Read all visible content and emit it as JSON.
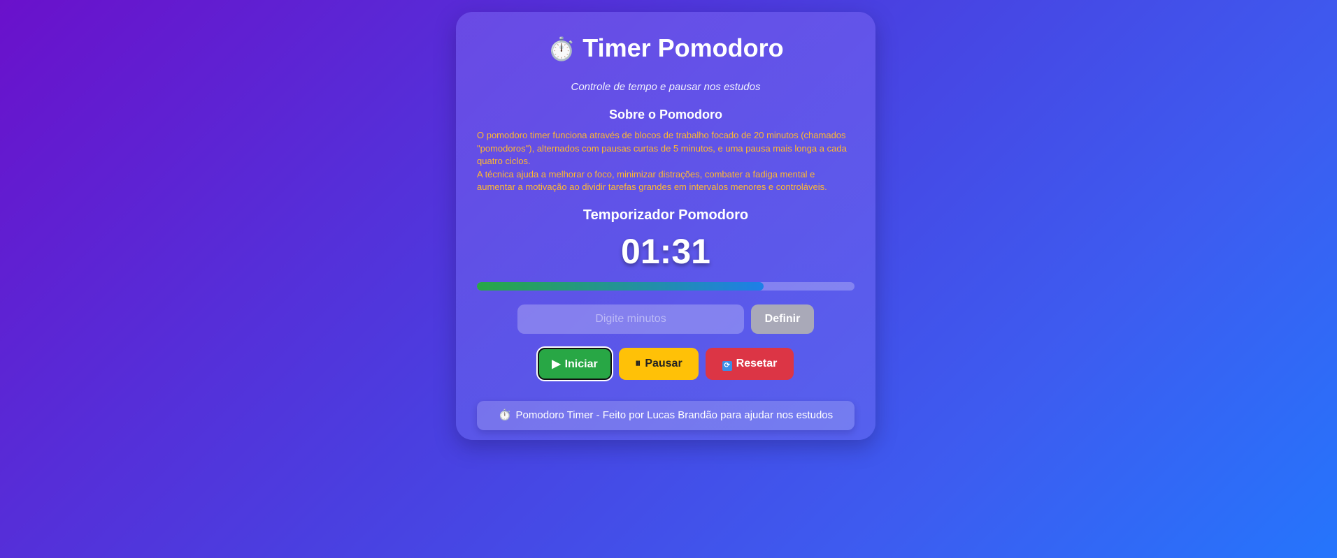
{
  "header": {
    "icon": "stopwatch-icon",
    "title": "Timer Pomodoro",
    "subtitle": "Controle de tempo e pausar nos estudos"
  },
  "about": {
    "title": "Sobre o Pomodoro",
    "paragraph1": "O pomodoro timer funciona através de blocos de trabalho focado de 20 minutos (chamados \"pomodoros\"), alternados com pausas curtas de 5 minutos, e uma pausa mais longa a cada quatro ciclos.",
    "paragraph2": "A técnica ajuda a melhorar o foco, minimizar distrações, combater a fadiga mental e aumentar a motivação ao dividir tarefas grandes em intervalos menores e controláveis."
  },
  "timer": {
    "title": "Temporizador Pomodoro",
    "display": "01:31",
    "progress_fraction": 0.76
  },
  "controls": {
    "minutes_placeholder": "Digite minutos",
    "minutes_value": "",
    "define_label": "Definir",
    "start_label": "Iniciar",
    "pause_label": "Pausar",
    "reset_label": "Resetar"
  },
  "footer": {
    "text": "Pomodoro Timer - Feito por Lucas Brandão para ajudar nos estudos"
  },
  "colors": {
    "accent_text": "#ffb830",
    "start": "#28a745",
    "pause": "#ffc107",
    "reset": "#dc3545",
    "define": "#a9a9b8"
  }
}
